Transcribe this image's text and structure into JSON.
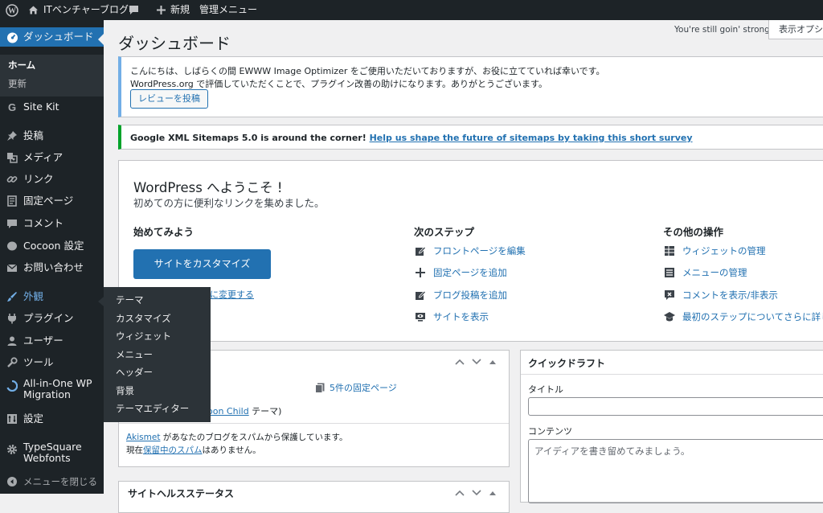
{
  "adminbar": {
    "site_name": "ITベンチャーブログ",
    "new_label": "新規",
    "manage_menu": "管理メニュー"
  },
  "sidebar": {
    "dashboard": "ダッシュボード",
    "sub_home": "ホーム",
    "sub_updates": "更新",
    "items": [
      {
        "icon": "google-icon",
        "label": "Site Kit"
      },
      {
        "icon": "pin-icon",
        "label": "投稿"
      },
      {
        "icon": "media-icon",
        "label": "メディア"
      },
      {
        "icon": "link-icon",
        "label": "リンク"
      },
      {
        "icon": "page-icon",
        "label": "固定ページ"
      },
      {
        "icon": "comment-icon",
        "label": "コメント"
      },
      {
        "icon": "cocoon-icon",
        "label": "Cocoon 設定"
      },
      {
        "icon": "mail-icon",
        "label": "お問い合わせ"
      },
      {
        "icon": "brush-icon",
        "label": "外観"
      },
      {
        "icon": "plugin-icon",
        "label": "プラグイン"
      },
      {
        "icon": "user-icon",
        "label": "ユーザー"
      },
      {
        "icon": "wrench-icon",
        "label": "ツール"
      },
      {
        "icon": "migration-icon",
        "label": "All-in-One WP Migration"
      },
      {
        "icon": "settings-icon",
        "label": "設定"
      },
      {
        "icon": "gear-icon",
        "label": "TypeSquare Webfonts"
      }
    ],
    "collapse": "メニューを閉じる"
  },
  "flyout": [
    "テーマ",
    "カスタマイズ",
    "ウィジェット",
    "メニュー",
    "ヘッダー",
    "背景",
    "テーマエディター"
  ],
  "header": {
    "title": "ダッシュボード",
    "still_strong": "You're still goin' strong",
    "screen_options": "表示オプシ"
  },
  "notice1": {
    "line1": "こんにちは、しばらくの間 EWWW Image Optimizer をご使用いただいておりますが、お役に立てていれば幸いです。",
    "line2": "WordPress.org で評価していただくことで、プラグイン改善の助けになります。ありがとうございます。",
    "button": "レビューを投稿"
  },
  "notice2": {
    "text": "Google XML Sitemaps 5.0 is around the corner!",
    "link": "Help us shape the future of sitemaps by taking this short survey"
  },
  "welcome": {
    "title": "WordPress へようこそ !",
    "subtitle": "初めての方に便利なリンクを集めました。",
    "col1_title": "始めてみよう",
    "customize_button": "サイトをカスタマイズ",
    "change_theme_link": "に変更する",
    "col2_title": "次のステップ",
    "col2_links": [
      "フロントページを編集",
      "固定ページを追加",
      "ブログ投稿を追加",
      "サイトを表示"
    ],
    "col3_title": "その他の操作",
    "col3_links": [
      "ウィジェットの管理",
      "メニューの管理",
      "コメントを表示/非表示",
      "最初のステップについてさらに詳し"
    ]
  },
  "glance": {
    "pages": "5件の固定ページ",
    "theme_link": "oon Child",
    "theme_suffix": " テーマ)",
    "akismet_link": "Akismet",
    "akismet_text": " があなたのブログをスパムから保護しています。",
    "spam_prefix": "現在",
    "spam_link": "保留中のスパム",
    "spam_suffix": "はありません。"
  },
  "health": {
    "title": "サイトヘルスステータス"
  },
  "quickdraft": {
    "title": "クイックドラフト",
    "title_label": "タイトル",
    "content_label": "コンテンツ",
    "content_placeholder": "アイディアを書き留めてみましょう。"
  }
}
